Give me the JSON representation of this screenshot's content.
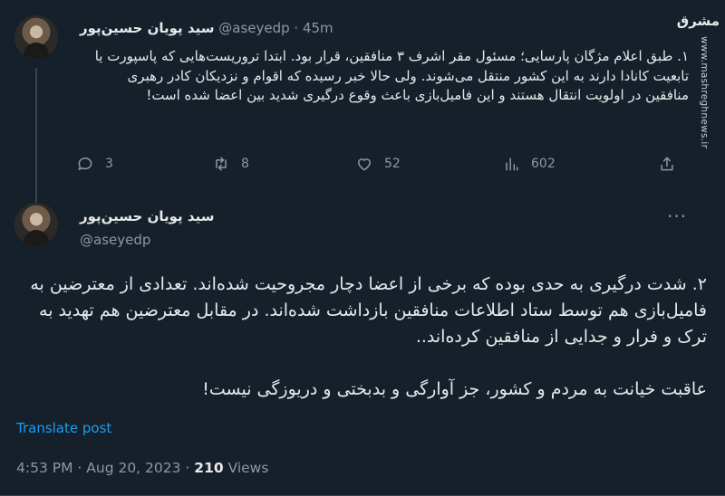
{
  "tweet1": {
    "name": "سید پویان حسین‌پور",
    "handle": "@aseyedp",
    "time": "· 45m",
    "text": "۱. طبق اعلام مژگان پارسایی؛ مسئول مقر اشرف ۳ منافقین، قرار بود. ابتدا تروریست‌هایی که پاسپورت یا تابعیت کانادا دارند به این کشور منتقل می‌شوند. ولی حالا خبر رسیده که اقوام و نزدیکان کادر رهبری منافقین در اولویت انتقال هستند و این فامیل‌بازی باعث وقوع درگیری شدید بین اعضا شده است!",
    "actions": {
      "replies": "3",
      "retweets": "8",
      "likes": "52",
      "views": "602"
    }
  },
  "tweet2": {
    "name": "سید پویان حسین‌پور",
    "handle": "@aseyedp",
    "paragraph1": "۲. شدت درگیری به حدی بوده که برخی از اعضا دچار مجروحیت شده‌اند. تعدادی از معترضین به فامیل‌بازی هم توسط ستاد اطلاعات منافقین بازداشت شده‌اند. در مقابل معترضین هم تهدید به ترک و فرار و جدایی از منافقین کرده‌اند..",
    "paragraph2": "عاقبت خیانت به مردم و کشور، جز آوارگی و بدبختی و دریوزگی نیست!",
    "translate": "Translate post",
    "meta": {
      "time": "4:53 PM",
      "date": "Aug 20, 2023",
      "views_count": "210",
      "views_label": "Views"
    }
  },
  "watermark": {
    "logo": "مشرق",
    "url": "www.mashreghnews.ir"
  },
  "colors": {
    "background": "#15202b",
    "text": "#e7e9ea",
    "secondary": "#8b98a5",
    "accent": "#1d9bf0",
    "divider": "#38444d"
  }
}
